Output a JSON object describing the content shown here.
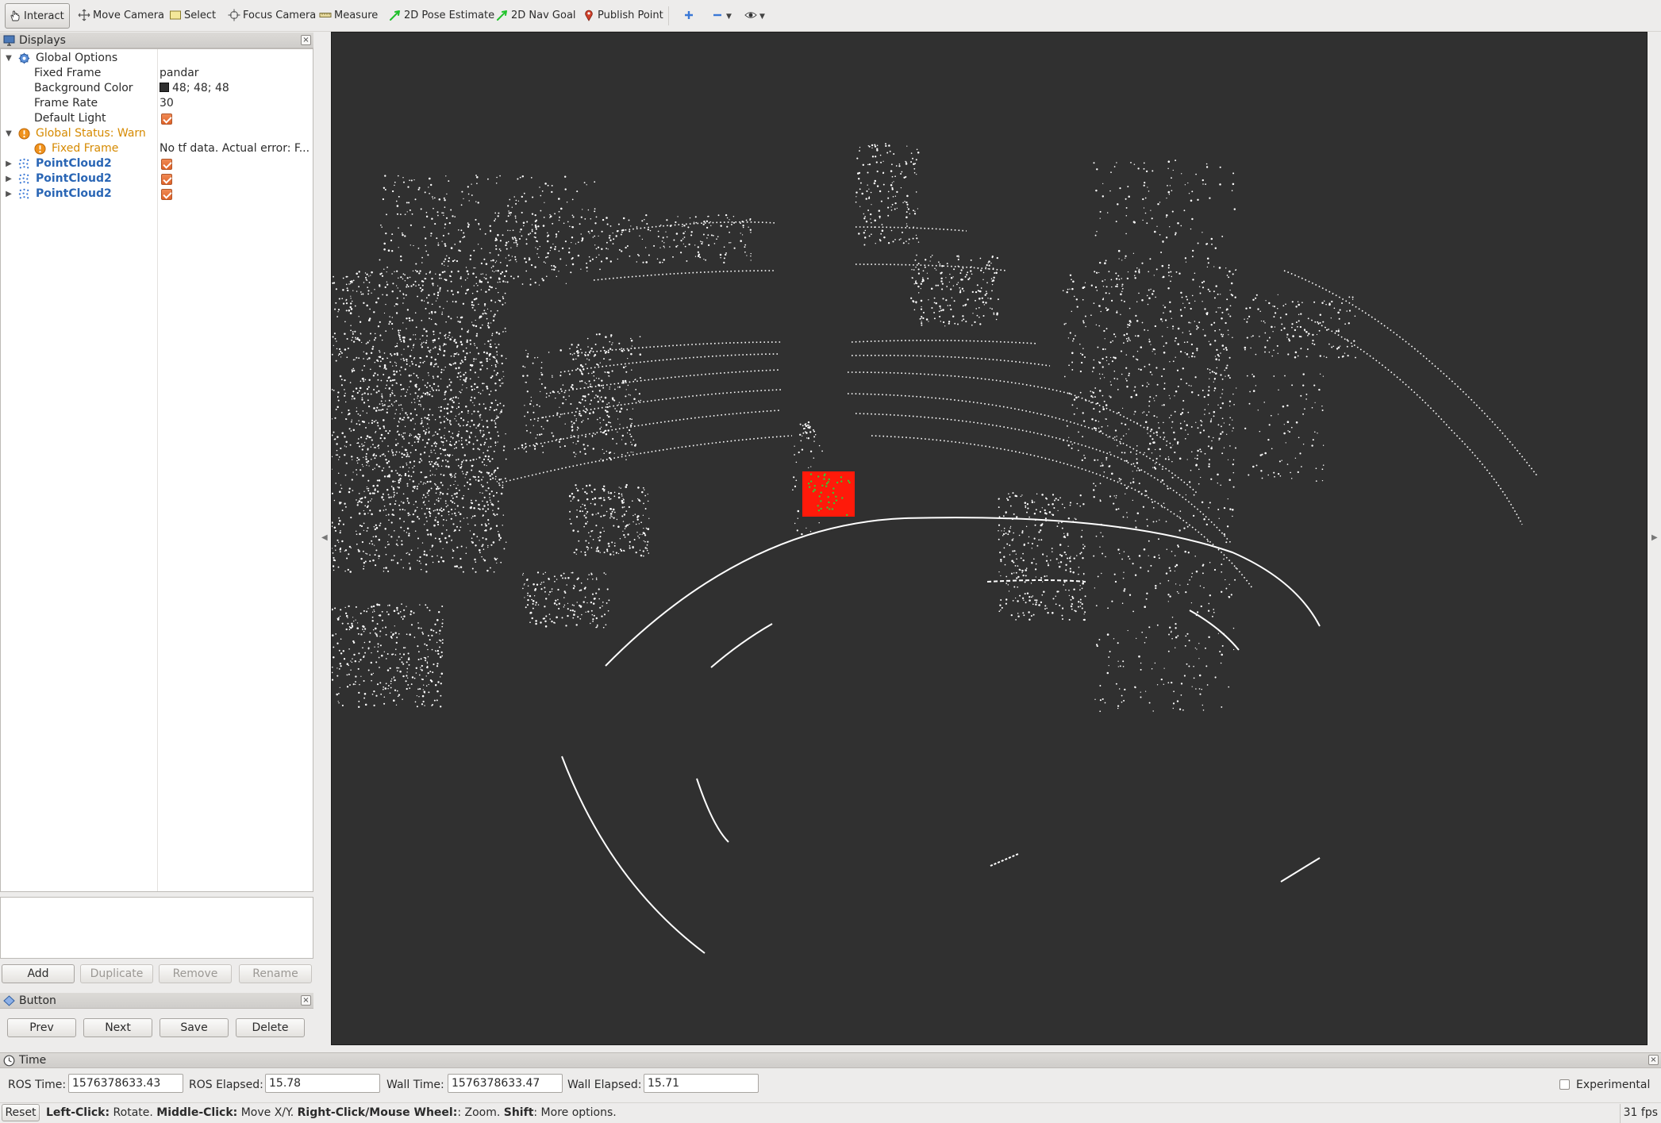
{
  "toolbar": {
    "interact": "Interact",
    "move_camera": "Move Camera",
    "select": "Select",
    "focus_camera": "Focus Camera",
    "measure": "Measure",
    "pose_estimate": "2D Pose Estimate",
    "nav_goal": "2D Nav Goal",
    "publish_point": "Publish Point"
  },
  "displays": {
    "title": "Displays",
    "global_options": "Global Options",
    "fixed_frame_label": "Fixed Frame",
    "fixed_frame_value": "pandar",
    "background_color_label": "Background Color",
    "background_color_value": "48; 48; 48",
    "frame_rate_label": "Frame Rate",
    "frame_rate_value": "30",
    "default_light_label": "Default Light",
    "global_status": "Global Status: Warn",
    "status_fixed_frame": "Fixed Frame",
    "status_fixed_frame_value": "No tf data.  Actual error: F...",
    "pointclouds": [
      "PointCloud2",
      "PointCloud2",
      "PointCloud2"
    ],
    "buttons": {
      "add": "Add",
      "duplicate": "Duplicate",
      "remove": "Remove",
      "rename": "Rename"
    }
  },
  "button_panel": {
    "title": "Button",
    "prev": "Prev",
    "next": "Next",
    "save": "Save",
    "delete": "Delete"
  },
  "time": {
    "title": "Time",
    "ros_time_label": "ROS Time:",
    "ros_time_value": "1576378633.43",
    "ros_elapsed_label": "ROS Elapsed:",
    "ros_elapsed_value": "15.78",
    "wall_time_label": "Wall Time:",
    "wall_time_value": "1576378633.47",
    "wall_elapsed_label": "Wall Elapsed:",
    "wall_elapsed_value": "15.71",
    "experimental": "Experimental"
  },
  "status": {
    "reset": "Reset",
    "left_click": "Left-Click:",
    "left_click_text": " Rotate. ",
    "middle_click": "Middle-Click:",
    "middle_click_text": " Move X/Y. ",
    "right_click": "Right-Click/Mouse Wheel:",
    "right_click_text": ": Zoom. ",
    "shift": "Shift",
    "shift_text": ": More options.",
    "fps": "31 fps"
  },
  "colors": {
    "viewport_bg": "#303030",
    "points": "#ffffff",
    "box": "#ff1a0a",
    "box_points": "#33cc33",
    "warn": "#d68a00",
    "display_link": "#2a66b5"
  },
  "icons": [
    "hand-icon",
    "move-camera-icon",
    "select-icon",
    "focus-camera-icon",
    "measure-icon",
    "pose-arrow-icon",
    "nav-goal-icon",
    "map-pin-icon",
    "plus-icon",
    "minus-icon",
    "eye-icon",
    "monitor-icon",
    "gear-icon",
    "warning-icon",
    "pointcloud-icon",
    "diamond-icon",
    "clock-icon"
  ]
}
